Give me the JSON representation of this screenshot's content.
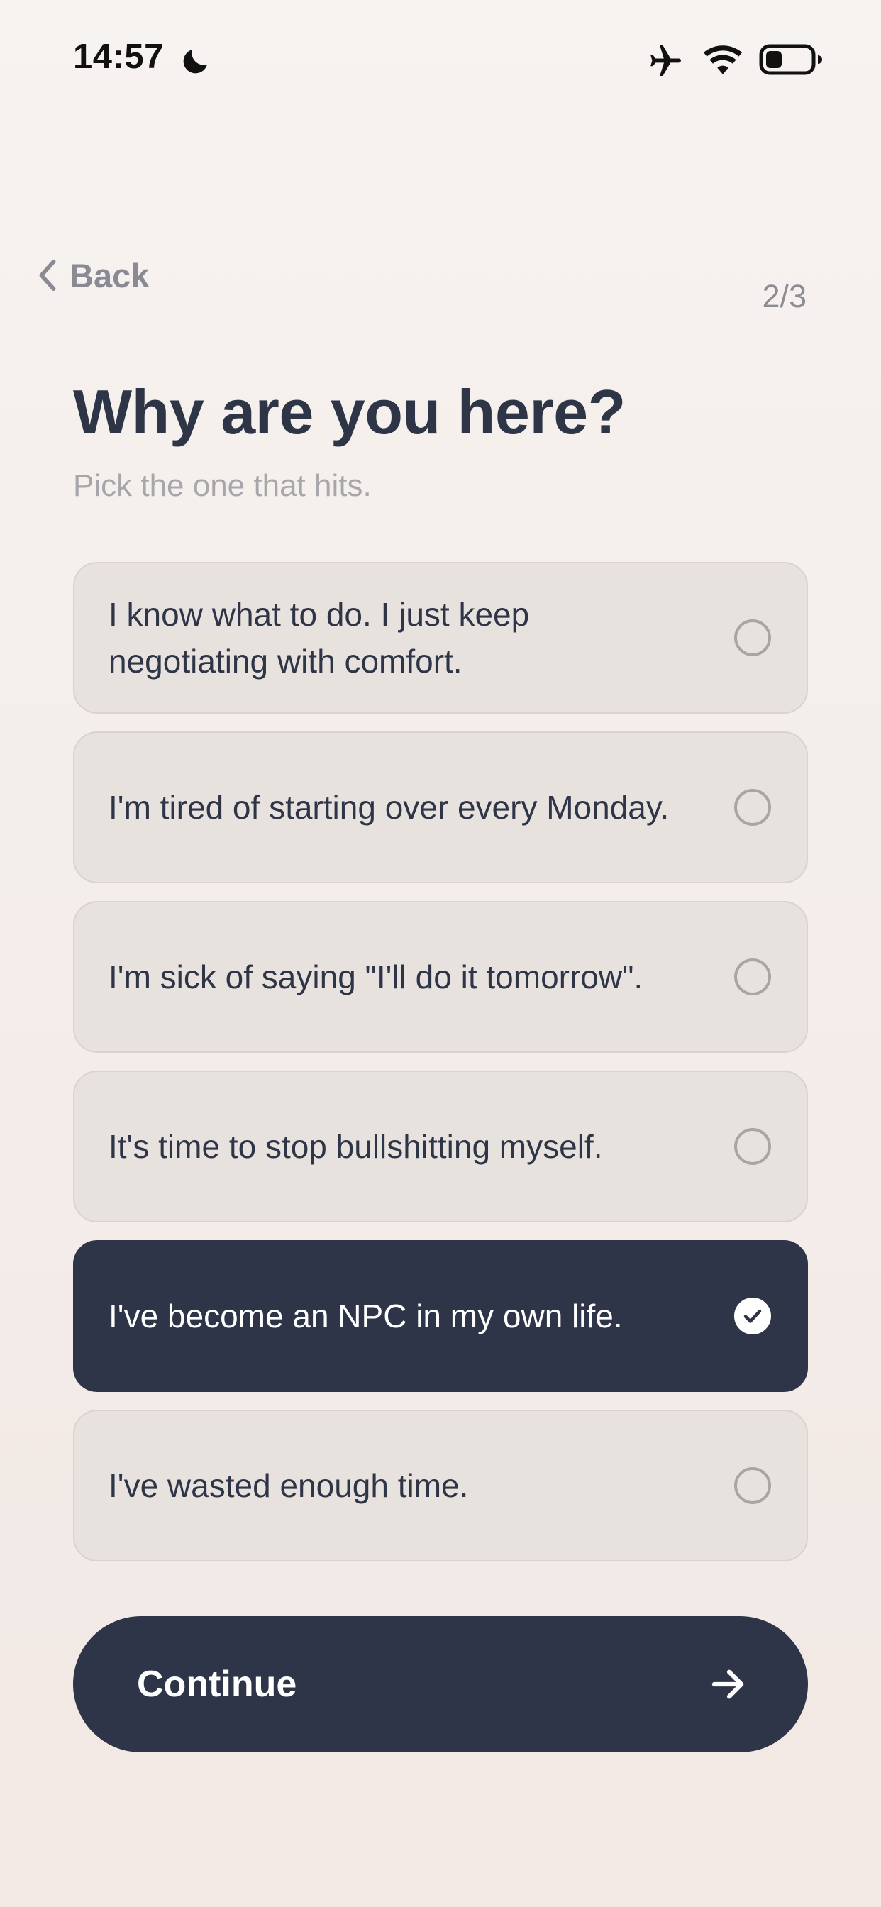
{
  "status_bar": {
    "time": "14:57",
    "icons": [
      "moon-icon",
      "airplane-icon",
      "wifi-icon",
      "battery-icon"
    ]
  },
  "nav": {
    "back_label": "Back",
    "step": "2/3"
  },
  "header": {
    "title": "Why are you here?",
    "subtitle": "Pick the one that hits."
  },
  "options": [
    {
      "label": "I know what to do. I just keep negotiating with comfort.",
      "selected": false
    },
    {
      "label": "I'm tired of starting over every Monday.",
      "selected": false
    },
    {
      "label": "I'm sick of saying \"I'll do it tomorrow\".",
      "selected": false
    },
    {
      "label": "It's time to stop bullshitting myself.",
      "selected": false
    },
    {
      "label": "I've become an NPC in my own life.",
      "selected": true
    },
    {
      "label": "I've wasted enough time.",
      "selected": false
    }
  ],
  "continue": {
    "label": "Continue"
  },
  "colors": {
    "primary": "#2e3548",
    "option_bg": "#e8e2df",
    "muted_text": "#a7a7ab",
    "background": "#f5efeb"
  }
}
